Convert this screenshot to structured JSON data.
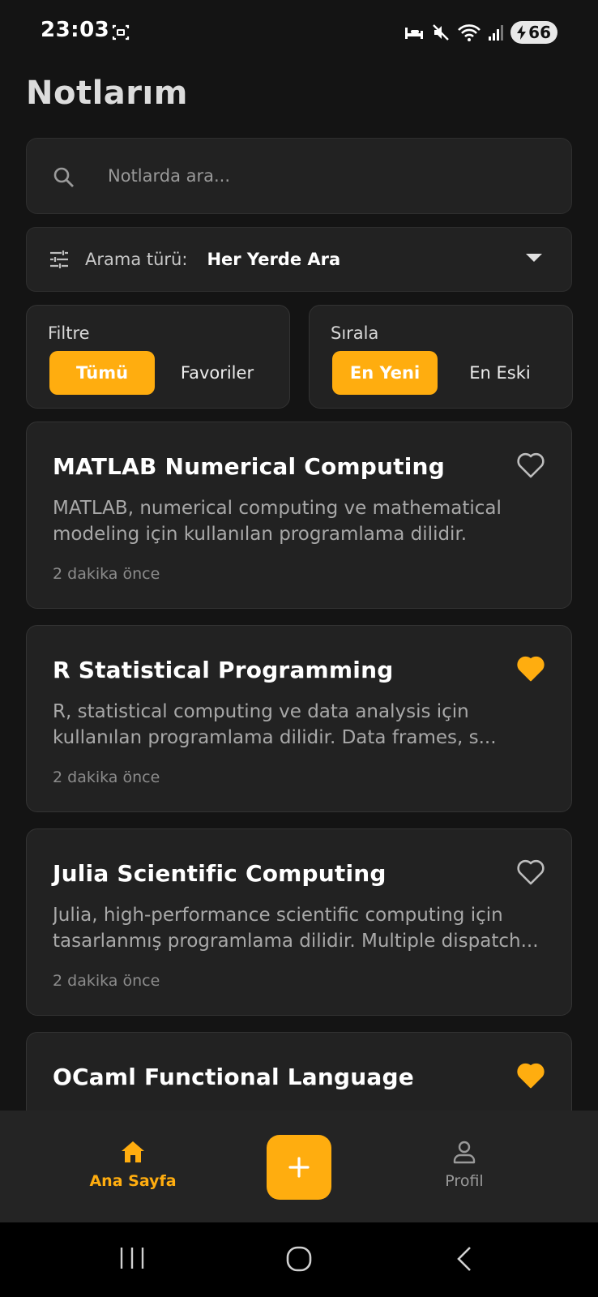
{
  "status_bar": {
    "time": "23:03",
    "battery": "66"
  },
  "header": {
    "title": "Notlarım"
  },
  "search": {
    "placeholder": "Notlarda ara..."
  },
  "search_type": {
    "label": "Arama türü:",
    "value": "Her Yerde Ara"
  },
  "filter": {
    "title": "Filtre",
    "options": [
      "Tümü",
      "Favoriler"
    ],
    "selected": "Tümü"
  },
  "sort": {
    "title": "Sırala",
    "options": [
      "En Yeni",
      "En Eski"
    ],
    "selected": "En Yeni"
  },
  "notes": [
    {
      "title": "MATLAB Numerical Computing",
      "body": "MATLAB, numerical computing ve mathematical modeling için kullanılan programlama dilidir.",
      "time": "2 dakika önce",
      "favorite": false
    },
    {
      "title": "R Statistical Programming",
      "body": "R, statistical computing ve data analysis için kullanılan programlama dilidir. Data frames, s...",
      "time": "2 dakika önce",
      "favorite": true
    },
    {
      "title": "Julia Scientific Computing",
      "body": "Julia, high-performance scientific computing için tasarlanmış programlama dilidir. Multiple dispatch...",
      "time": "2 dakika önce",
      "favorite": false
    },
    {
      "title": "OCaml Functional Language",
      "body": "",
      "time": "",
      "favorite": true
    }
  ],
  "bottom_nav": {
    "home_label": "Ana Sayfa",
    "profile_label": "Profil"
  },
  "colors": {
    "accent": "#ffad0f",
    "background": "#141414",
    "card": "#222222"
  }
}
